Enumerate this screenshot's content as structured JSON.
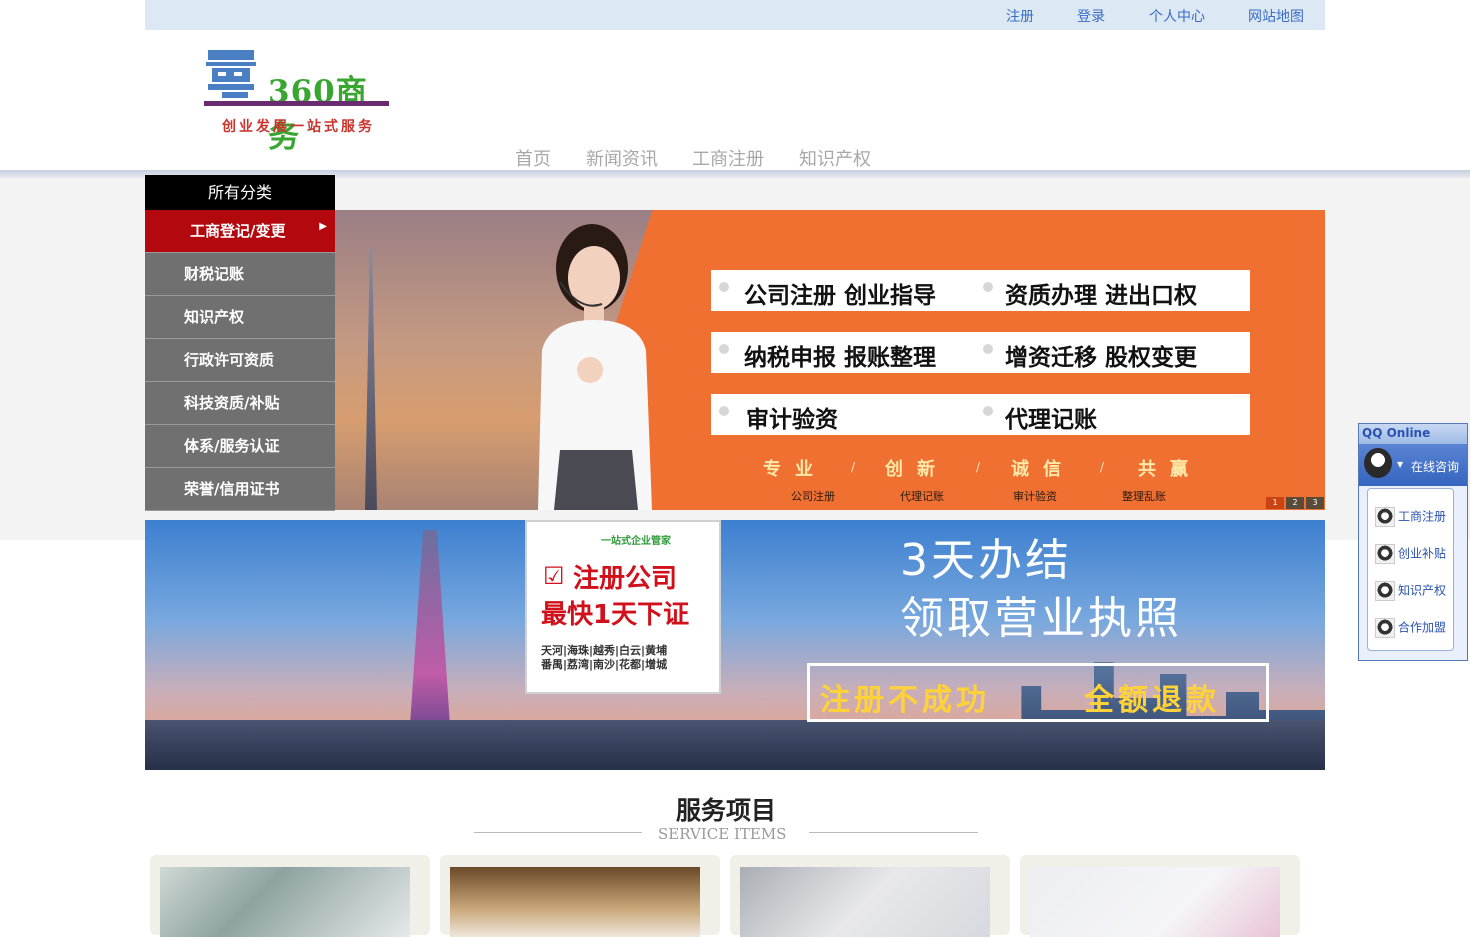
{
  "topbar": {
    "links": [
      "注册",
      "登录",
      "个人中心",
      "网站地图"
    ]
  },
  "logo": {
    "icon": "logo-mark",
    "name": "360商务",
    "tagline": "创业发展一站式服务"
  },
  "nav": [
    "首页",
    "新闻资讯",
    "工商注册",
    "知识产权"
  ],
  "category_menu": {
    "header": "所有分类",
    "items": [
      "工商登记/变更",
      "财税记账",
      "知识产权",
      "行政许可资质",
      "科技资质/补贴",
      "体系/服务认证",
      "荣誉/信用证书"
    ],
    "active_index": 0
  },
  "banner1": {
    "rows": [
      [
        "公司注册  创业指导",
        "资质办理 进出口权"
      ],
      [
        "纳税申报  报账整理",
        "增资迁移 股权变更"
      ],
      [
        "审计验资",
        "代理记账"
      ]
    ],
    "values": [
      "专业",
      "创新",
      "诚信",
      "共赢"
    ],
    "subs": [
      "公司注册",
      "代理记账",
      "审计验资",
      "整理乱账"
    ],
    "pager": [
      "1",
      "2",
      "3"
    ]
  },
  "banner2": {
    "card_small": "一站式企业管家",
    "card_title1": "注册公司",
    "card_title2": "最快1天下证",
    "card_areas1": "天河|海珠|越秀|白云|黄埔",
    "card_areas2": "番禺|荔湾|南沙|花都|增城",
    "headline1": "3天办结",
    "headline2": "领取营业执照",
    "refund_left": "注册不成功",
    "refund_right": "全额退款"
  },
  "services": {
    "title": "服务项目",
    "subtitle": "SERVICE ITEMS"
  },
  "qq_widget": {
    "header": "QQ Online",
    "main_label": "在线咨询",
    "items": [
      "工商注册",
      "创业补贴",
      "知识产权",
      "合作加盟"
    ]
  },
  "colors": {
    "topbar_bg": "#dde8f5",
    "link": "#3a6cc4",
    "active_cat": "#b3080e",
    "cat_bg": "#707070",
    "banner_orange": "#f07032"
  }
}
